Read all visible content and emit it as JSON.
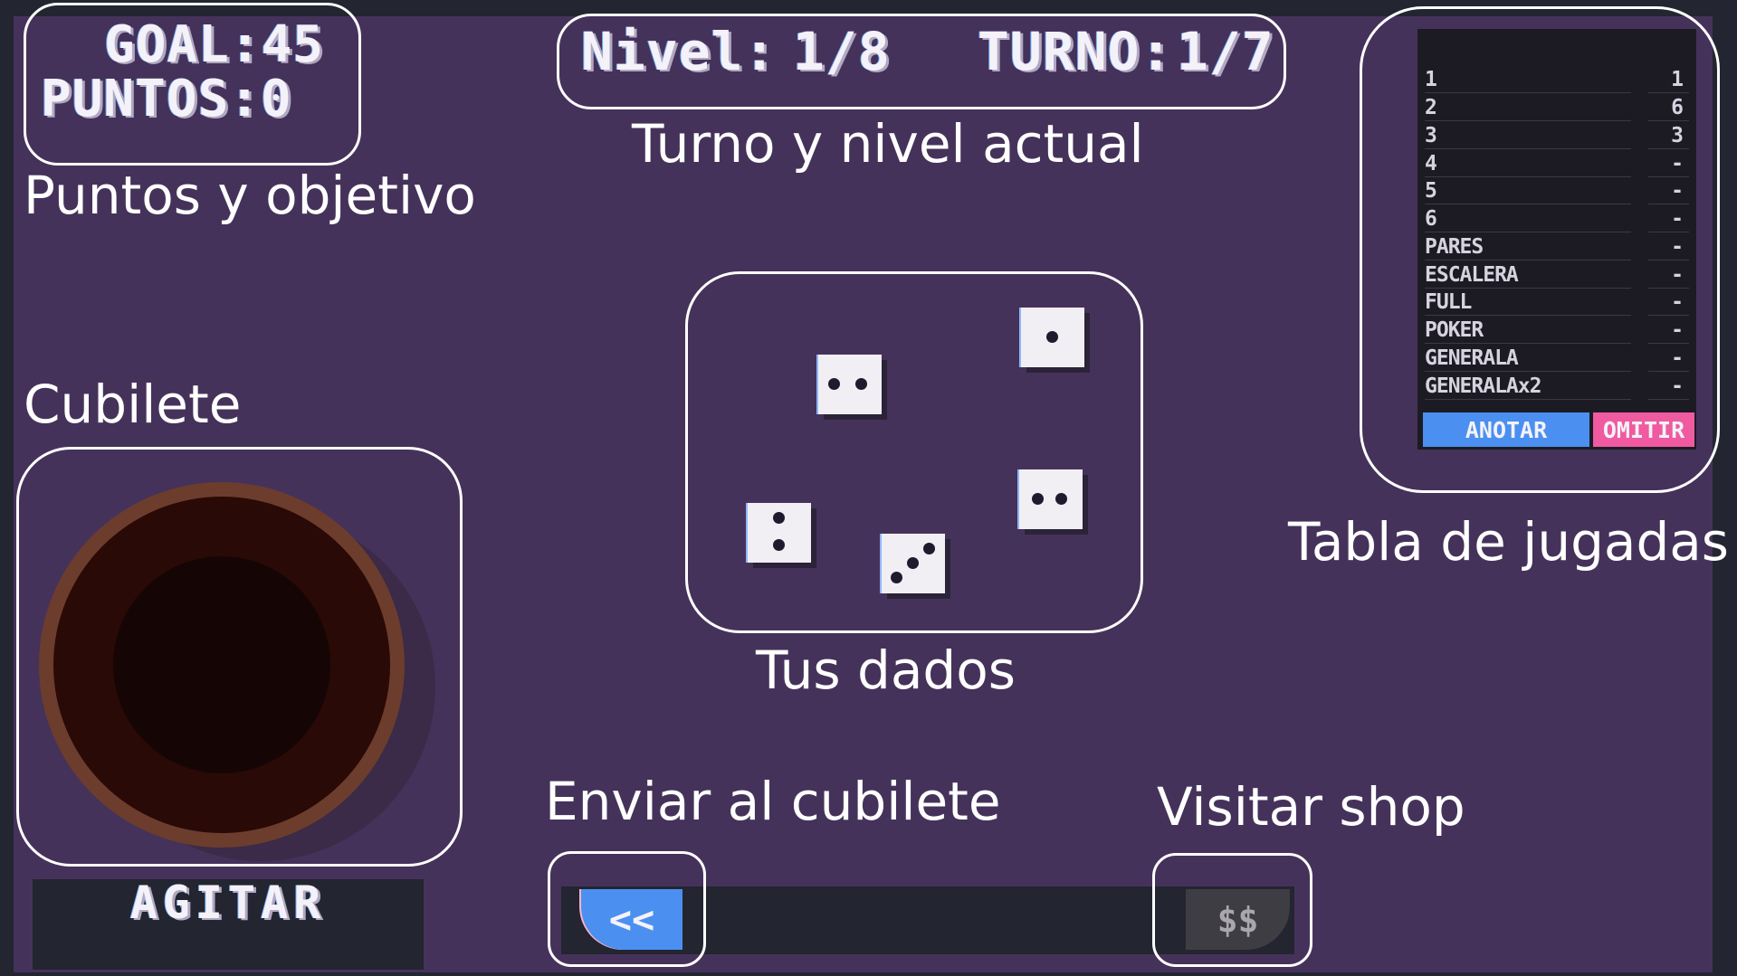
{
  "hud": {
    "goal_text": "GOAL:45",
    "points_text": "PUNTOS:0",
    "level_label": "Nivel:",
    "level_value": "1/8",
    "turn_label": "TURNO:",
    "turn_value": "1/7"
  },
  "annotations": {
    "points_goal": "Puntos y objetivo",
    "turn_level": "Turno y nivel actual",
    "cup": "Cubilete",
    "dice": "Tus dados",
    "scoreboard": "Tabla de jugadas",
    "send_to_cup": "Enviar al cubilete",
    "visit_shop": "Visitar shop"
  },
  "dice": [
    {
      "name": "die-two-a",
      "value": 2
    },
    {
      "name": "die-one",
      "value": 1
    },
    {
      "name": "die-two-vertical",
      "value": 2
    },
    {
      "name": "die-three",
      "value": 3
    },
    {
      "name": "die-two-b",
      "value": 2
    }
  ],
  "score_table": {
    "rows": [
      {
        "label": "1",
        "value": "1"
      },
      {
        "label": "2",
        "value": "6"
      },
      {
        "label": "3",
        "value": "3"
      },
      {
        "label": "4",
        "value": "-"
      },
      {
        "label": "5",
        "value": "-"
      },
      {
        "label": "6",
        "value": "-"
      },
      {
        "label": "PARES",
        "value": "-"
      },
      {
        "label": "ESCALERA",
        "value": "-"
      },
      {
        "label": "FULL",
        "value": "-"
      },
      {
        "label": "POKER",
        "value": "-"
      },
      {
        "label": "GENERALA",
        "value": "-"
      },
      {
        "label": "GENERALAx2",
        "value": "-"
      }
    ],
    "score_button": "ANOTAR",
    "skip_button": "OMITIR"
  },
  "controls": {
    "shake_button": "AGITAR",
    "back_button": "<<",
    "shop_button": "$$"
  },
  "colors": {
    "background": "#45325a",
    "score_accent": "#4b90f0",
    "skip_accent": "#ef5aa0"
  }
}
